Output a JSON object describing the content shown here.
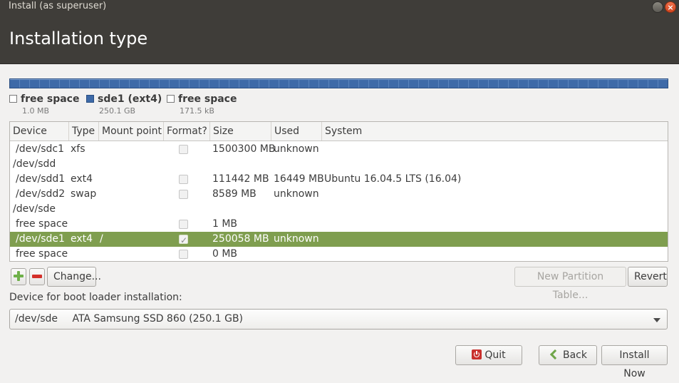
{
  "window": {
    "title": "Install (as superuser)",
    "close_glyph": "×"
  },
  "page": {
    "title": "Installation type"
  },
  "legend": [
    {
      "name": "free space",
      "size": "1.0 MB",
      "color": "#ffffff"
    },
    {
      "name": "sde1 (ext4)",
      "size": "250.1 GB",
      "color": "#3e6aa8"
    },
    {
      "name": "free space",
      "size": "171.5 kB",
      "color": "#ffffff"
    }
  ],
  "table": {
    "columns": [
      "Device",
      "Type",
      "Mount point",
      "Format?",
      "Size",
      "Used",
      "System"
    ],
    "rows": [
      {
        "device": "/dev/sdc1",
        "type": "xfs",
        "mount": "",
        "format": "unchecked",
        "size": "1500300 MB",
        "used": "unknown",
        "system": ""
      },
      {
        "device": "/dev/sdd",
        "type": "",
        "mount": "",
        "format": "",
        "size": "",
        "used": "",
        "system": ""
      },
      {
        "device": "/dev/sdd1",
        "type": "ext4",
        "mount": "",
        "format": "unchecked",
        "size": "111442 MB",
        "used": "16449 MB",
        "system": "Ubuntu 16.04.5 LTS (16.04)"
      },
      {
        "device": "/dev/sdd2",
        "type": "swap",
        "mount": "",
        "format": "unchecked",
        "size": "8589 MB",
        "used": "unknown",
        "system": ""
      },
      {
        "device": "/dev/sde",
        "type": "",
        "mount": "",
        "format": "",
        "size": "",
        "used": "",
        "system": ""
      },
      {
        "device": "free space",
        "type": "",
        "mount": "",
        "format": "unchecked",
        "size": "1 MB",
        "used": "",
        "system": ""
      },
      {
        "device": "/dev/sde1",
        "type": "ext4",
        "mount": "/",
        "format": "checked",
        "size": "250058 MB",
        "used": "unknown",
        "system": "",
        "selected": true
      },
      {
        "device": "free space",
        "type": "",
        "mount": "",
        "format": "unchecked",
        "size": "0 MB",
        "used": "",
        "system": ""
      }
    ]
  },
  "toolbar": {
    "change": "Change...",
    "new_table": "New Partition Table...",
    "revert": "Revert"
  },
  "bootloader": {
    "label": "Device for boot loader installation:",
    "device": "/dev/sde",
    "description": "ATA Samsung SSD 860 (250.1 GB)"
  },
  "buttons": {
    "quit": "Quit",
    "back": "Back",
    "install": "Install Now"
  },
  "colors": {
    "selection": "#7f9e4f",
    "disk_bar": "#3e6aa8",
    "titlebar": "#3f3d39"
  }
}
